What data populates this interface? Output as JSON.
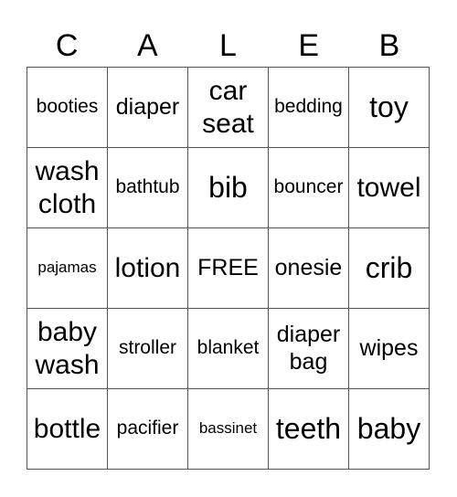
{
  "header": [
    "C",
    "A",
    "L",
    "E",
    "B"
  ],
  "rows": [
    [
      "booties",
      "diaper",
      "car seat",
      "bedding",
      "toy"
    ],
    [
      "wash cloth",
      "bathtub",
      "bib",
      "bouncer",
      "towel"
    ],
    [
      "pajamas",
      "lotion",
      "FREE",
      "onesie",
      "crib"
    ],
    [
      "baby wash",
      "stroller",
      "blanket",
      "diaper bag",
      "wipes"
    ],
    [
      "bottle",
      "pacifier",
      "bassinet",
      "teeth",
      "baby"
    ]
  ]
}
